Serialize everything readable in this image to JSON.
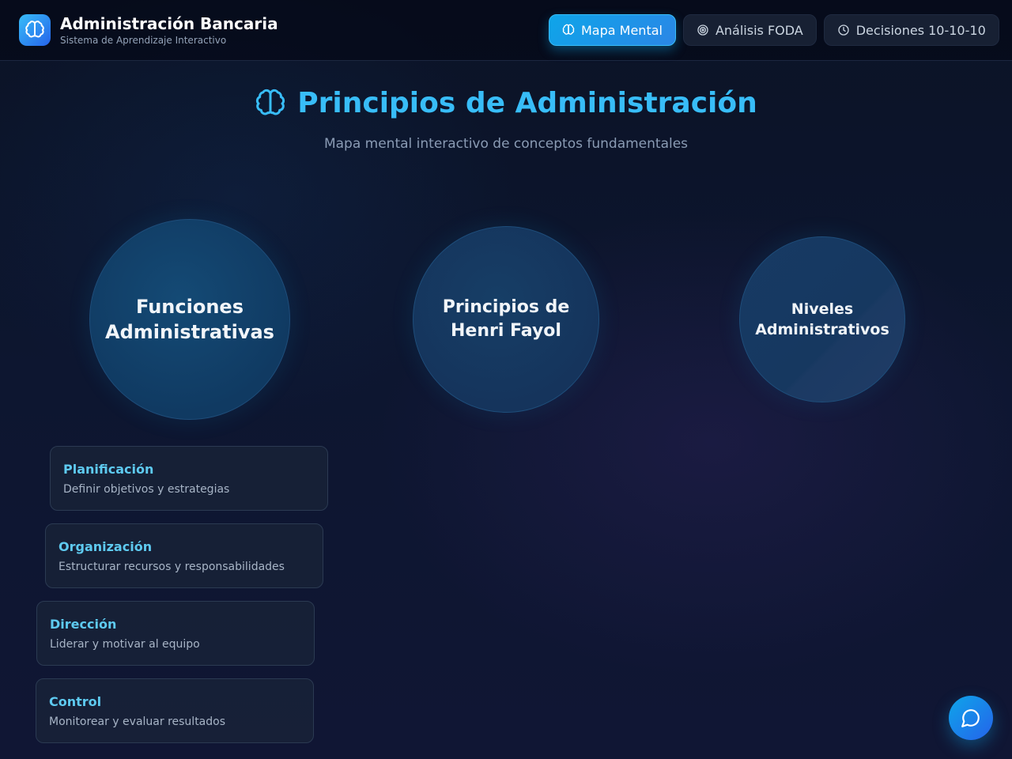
{
  "header": {
    "logo_icon": "brain-icon",
    "title": "Administración Bancaria",
    "subtitle": "Sistema de Aprendizaje Interactivo",
    "nav": [
      {
        "label": "Mapa Mental",
        "icon": "brain-icon",
        "active": true
      },
      {
        "label": "Análisis FODA",
        "icon": "target-icon",
        "active": false
      },
      {
        "label": "Decisiones 10-10-10",
        "icon": "clock-icon",
        "active": false
      }
    ]
  },
  "hero": {
    "icon": "brain-icon",
    "title": "Principios de Administración",
    "subtitle": "Mapa mental interactivo de conceptos fundamentales"
  },
  "mindmap": {
    "nodes": [
      {
        "label": "Funciones Administrativas"
      },
      {
        "label": "Principios de Henri Fayol"
      },
      {
        "label": "Niveles Administrativos"
      }
    ],
    "subitems": [
      {
        "title": "Planificación",
        "description": "Definir objetivos y estrategias"
      },
      {
        "title": "Organización",
        "description": "Estructurar recursos y responsabilidades"
      },
      {
        "title": "Dirección",
        "description": "Liderar y motivar al equipo"
      },
      {
        "title": "Control",
        "description": "Monitorear y evaluar resultados"
      }
    ]
  },
  "chat": {
    "icon": "chat-bubble-icon"
  },
  "colors": {
    "accent": "#38bdf8",
    "accent_gradient_end": "#2563eb",
    "background": "#0d1630",
    "card_title": "#5ecaf0"
  }
}
